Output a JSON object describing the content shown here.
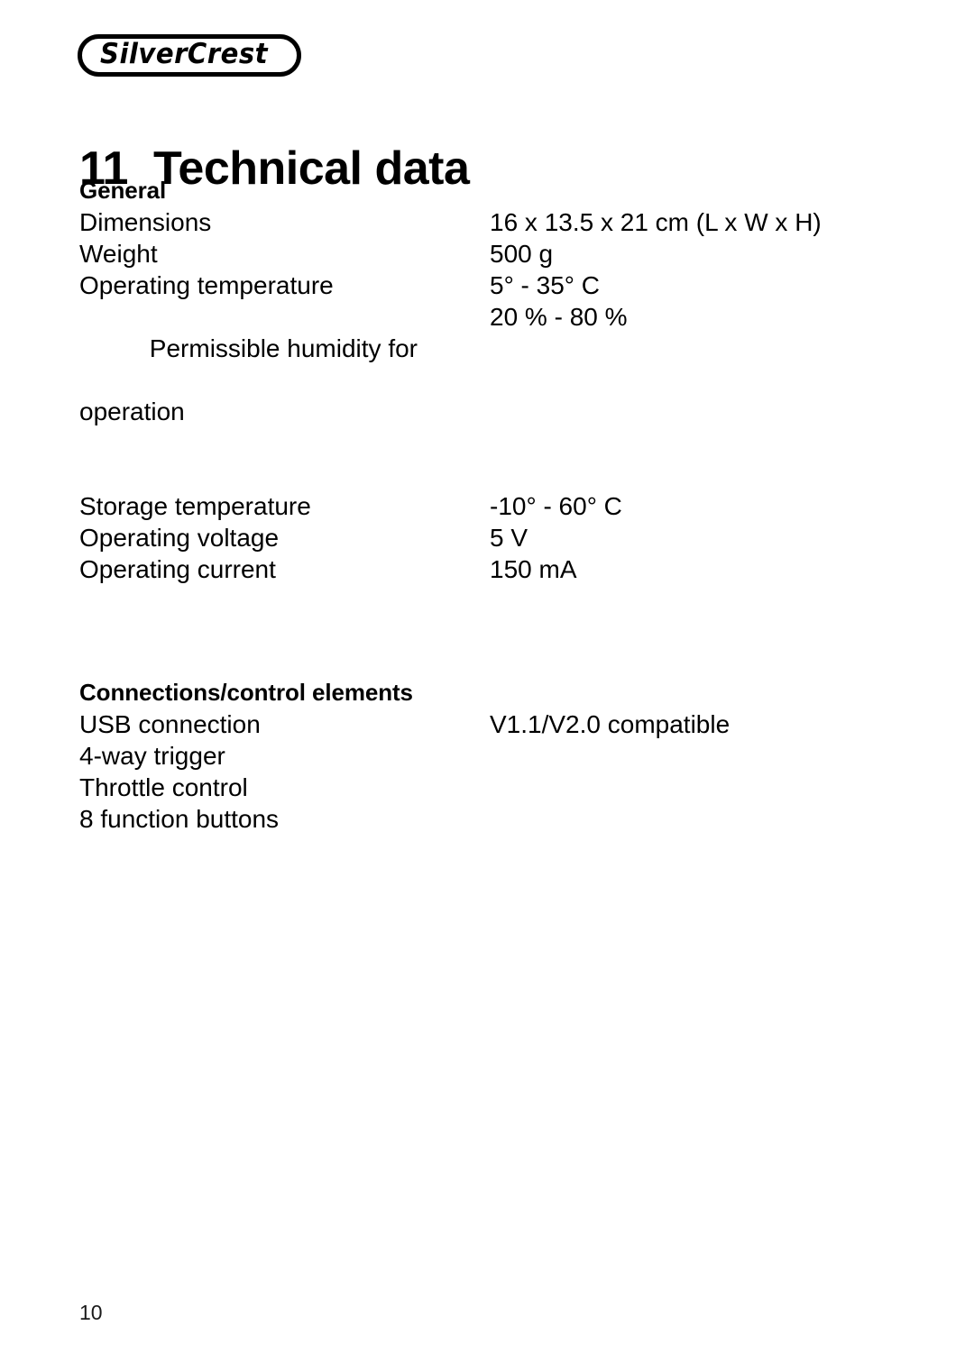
{
  "brand": {
    "logo_text": "SilverCrest"
  },
  "heading": {
    "number": "11",
    "title": "Technical data"
  },
  "sections": [
    {
      "heading": "General",
      "rows": [
        {
          "label": "Dimensions",
          "label_cont": "",
          "value": "16 x 13.5 x 21 cm (L x W x H)"
        },
        {
          "label": "Weight",
          "label_cont": "",
          "value": "500 g"
        },
        {
          "label": "Operating temperature",
          "label_cont": "",
          "value": "5° - 35° C"
        },
        {
          "label": "Permissible humidity for",
          "label_cont": "operation",
          "value": "20 % - 80 %"
        },
        {
          "label": "Storage temperature",
          "label_cont": "",
          "value": "-10° - 60° C"
        },
        {
          "label": "Operating voltage",
          "label_cont": "",
          "value": "5 V"
        },
        {
          "label": "Operating current",
          "label_cont": "",
          "value": "150 mA"
        }
      ]
    },
    {
      "heading": "Connections/control elements",
      "rows": [
        {
          "label": "USB connection",
          "label_cont": "",
          "value": "V1.1/V2.0 compatible"
        },
        {
          "label": "4-way trigger",
          "label_cont": "",
          "value": ""
        },
        {
          "label": "Throttle control",
          "label_cont": "",
          "value": ""
        },
        {
          "label": "8 function buttons",
          "label_cont": "",
          "value": ""
        }
      ]
    }
  ],
  "footer": {
    "page_number": "10"
  }
}
